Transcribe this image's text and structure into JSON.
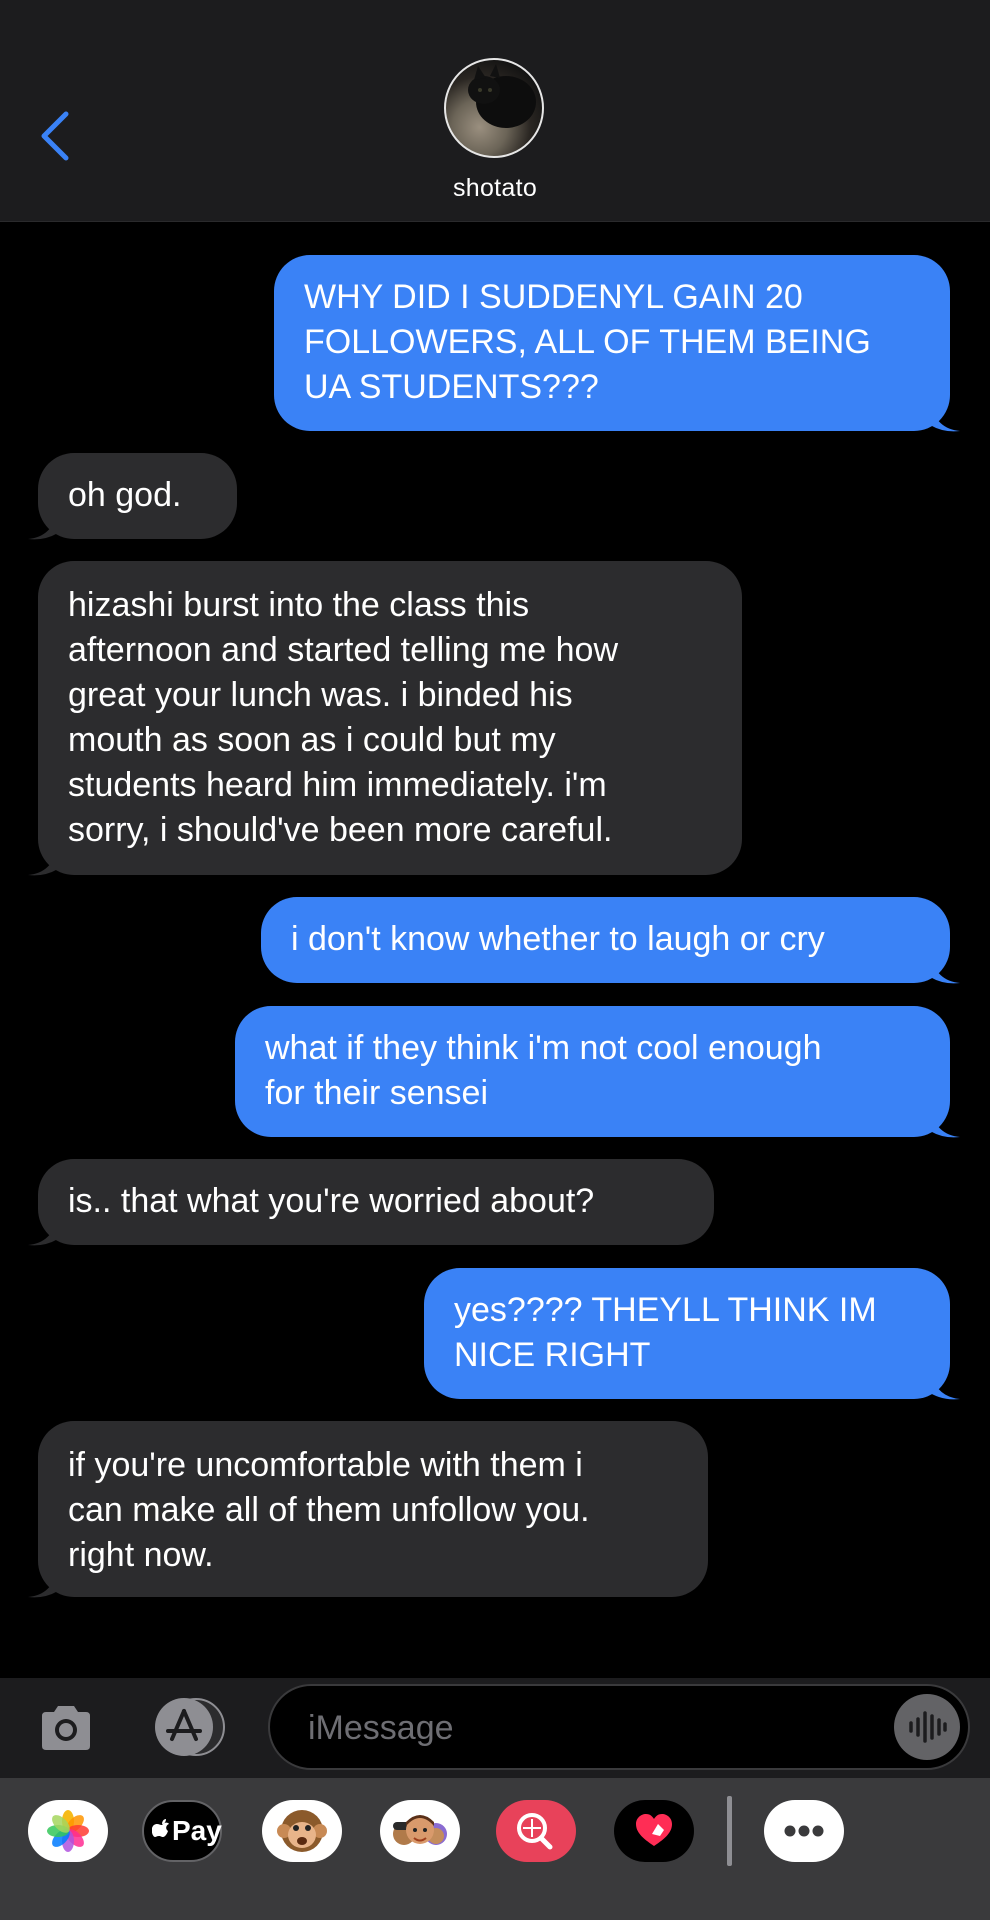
{
  "header": {
    "contact_name": "shotato"
  },
  "messages": [
    {
      "direction": "outgoing",
      "text": "WHY DID I SUDDENYL GAIN 20\nFOLLOWERS, ALL OF THEM BEING\nUA STUDENTS???"
    },
    {
      "direction": "incoming",
      "text": "oh god."
    },
    {
      "direction": "incoming",
      "text": "hizashi burst into the class this\nafternoon and started telling me how\ngreat your lunch was. i binded his\nmouth as soon as i could but my\nstudents heard him immediately. i'm\nsorry, i should've been more careful."
    },
    {
      "direction": "outgoing",
      "text": "i don't know whether to laugh or cry"
    },
    {
      "direction": "outgoing",
      "text": "what if they think i'm not cool enough\nfor their sensei"
    },
    {
      "direction": "incoming",
      "text": "is.. that what you're worried about?"
    },
    {
      "direction": "outgoing",
      "text": "yes???? THEYLL THINK IM\nNICE RIGHT"
    },
    {
      "direction": "incoming",
      "text": "if you're uncomfortable with them i\ncan make all of them unfollow you.\nright now."
    }
  ],
  "input": {
    "placeholder": "iMessage"
  },
  "drawer": {
    "apple_pay_label": "Pay"
  },
  "colors": {
    "outgoing_bubble": "#3a82f6",
    "incoming_bubble": "#2c2c2e",
    "accent": "#3a82f6"
  }
}
